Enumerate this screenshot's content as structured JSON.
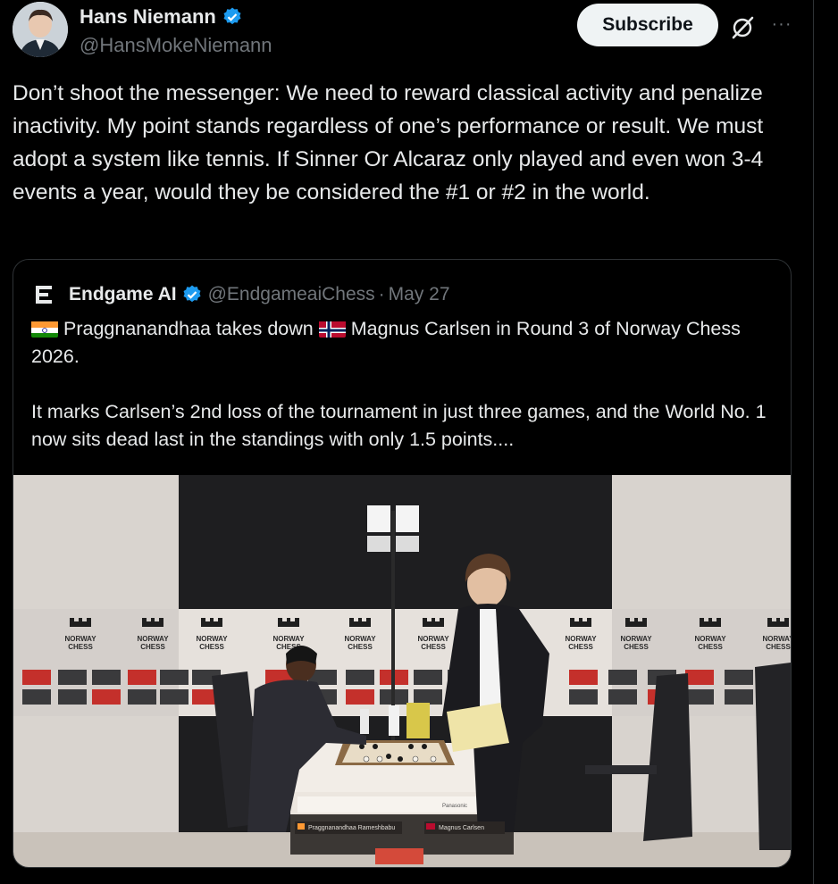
{
  "author": {
    "display_name": "Hans Niemann",
    "handle": "@HansMokeNiemann",
    "verified": true,
    "verified_color": "#1d9bf0"
  },
  "actions": {
    "subscribe_label": "Subscribe",
    "grok_icon": "grok-icon",
    "more_icon": "more-icon",
    "more_glyph": "···"
  },
  "tweet": {
    "text": "Don’t shoot the messenger: We need to reward classical activity and penalize inactivity. My point stands regardless of one’s performance or result. We must adopt a system like tennis. If Sinner Or Alcaraz only played and even won 3-4 events a year, would they be considered the #1 or #2 in the world."
  },
  "quoted": {
    "display_name": "Endgame AI",
    "handle": "@EndgameaiChess",
    "separator": "·",
    "date": "May 27",
    "verified": true,
    "line1_part1": "Praggnanandhaa takes down ",
    "line1_part2": "Magnus Carlsen in Round 3 of Norway Chess 2026.",
    "paragraph2": "It marks Carlsen’s 2nd loss of the tournament in just three games, and the World No. 1 now sits dead last in the standings with only 1.5 points....",
    "flag1_icon": "india-flag-icon",
    "flag2_icon": "norway-flag-icon"
  },
  "media": {
    "banner_text": "NORWAY\nCHESS",
    "board_label_left": "Praggnanandhaa Rameshbabu",
    "board_label_right": "Magnus Carlsen",
    "sponsor_label": "Panasonic",
    "colors": {
      "backdrop": "#1c1c1e",
      "wall_left": "#d9d4cf",
      "floor": "#c9c2ba",
      "table": "#f2ede7",
      "accent_red": "#c4302b"
    }
  }
}
